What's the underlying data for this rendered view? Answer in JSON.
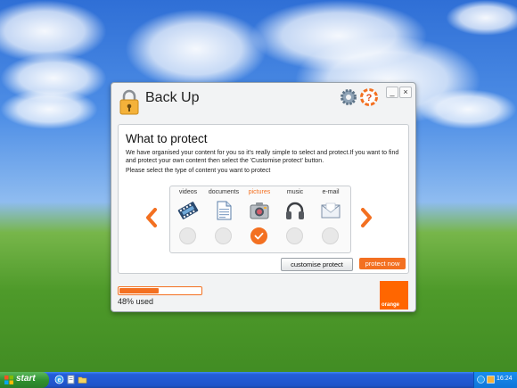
{
  "window": {
    "title": "Back Up",
    "controls": {
      "minimize": "_",
      "close": "×"
    }
  },
  "panel": {
    "title": "What to protect",
    "description": "We have organised your content for you so it's really simple to select and protect.If you want to find and protect your own content then select the 'Customise protect' button.",
    "prompt": "Please select the type of content you want to protect"
  },
  "categories": [
    {
      "label": "videos",
      "icon": "film-icon",
      "selected": false
    },
    {
      "label": "documents",
      "icon": "document-icon",
      "selected": false
    },
    {
      "label": "pictures",
      "icon": "camera-icon",
      "selected": true
    },
    {
      "label": "music",
      "icon": "headphones-icon",
      "selected": false
    },
    {
      "label": "e-mail",
      "icon": "envelope-icon",
      "selected": false
    }
  ],
  "buttons": {
    "customise": "customise protect",
    "protect": "protect now"
  },
  "usage": {
    "text": "48% used",
    "fraction": 0.48
  },
  "brand": {
    "logo_text": "orange",
    "accent": "#f37021"
  },
  "taskbar": {
    "start_label": "start",
    "clock": "16:24"
  }
}
